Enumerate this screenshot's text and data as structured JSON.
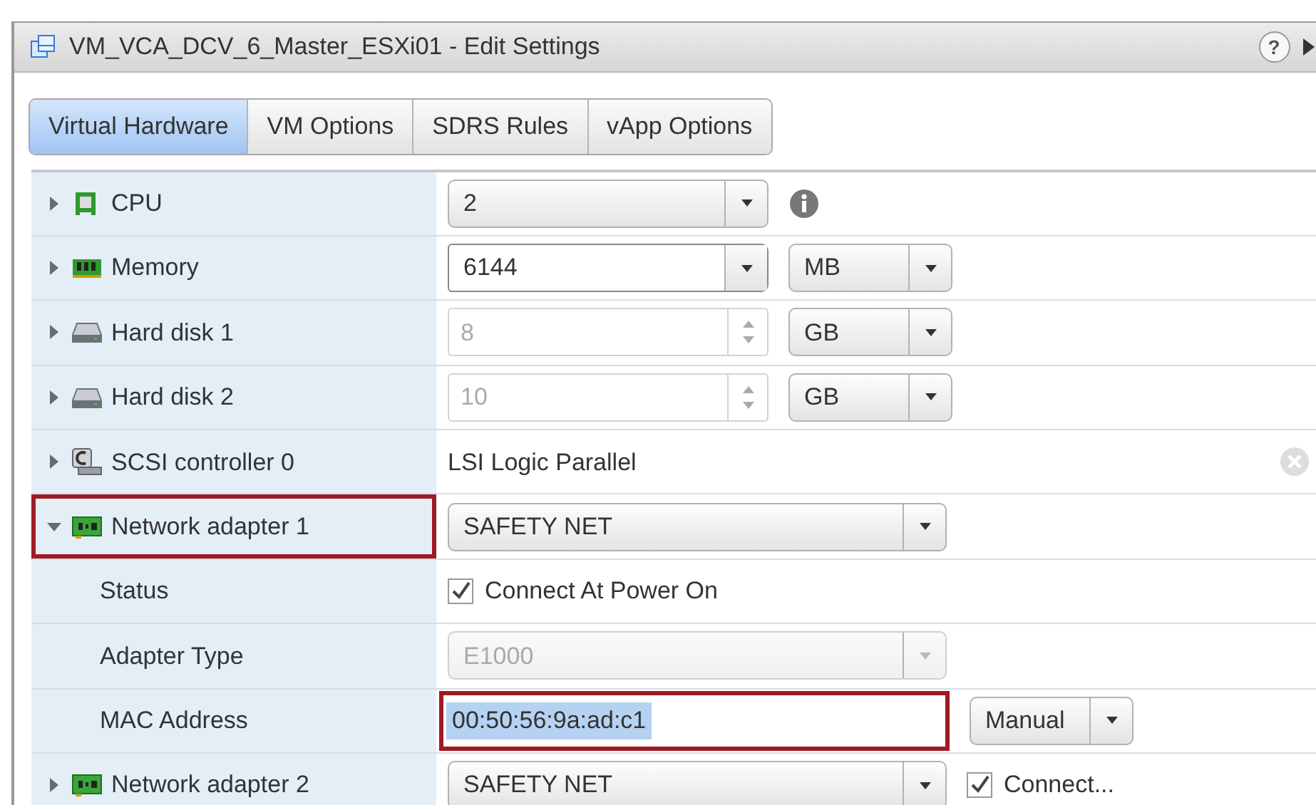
{
  "window": {
    "title": "VM_VCA_DCV_6_Master_ESXi01 - Edit Settings",
    "help": "?"
  },
  "tabs": [
    {
      "label": "Virtual Hardware",
      "selected": true
    },
    {
      "label": "VM Options",
      "selected": false
    },
    {
      "label": "SDRS Rules",
      "selected": false
    },
    {
      "label": "vApp Options",
      "selected": false
    }
  ],
  "rows": [
    {
      "kind": "cpu",
      "label": "CPU",
      "expanded": false,
      "outlined": false,
      "controls": [
        {
          "kind": "count-select",
          "value": "2",
          "disabled": false
        },
        {
          "kind": "info"
        }
      ]
    },
    {
      "kind": "memory",
      "label": "Memory",
      "expanded": false,
      "outlined": false,
      "controls": [
        {
          "kind": "combo",
          "value": "6144",
          "disabled": false
        },
        {
          "kind": "unit-select",
          "value": "MB",
          "disabled": false
        }
      ]
    },
    {
      "kind": "disk",
      "label": "Hard disk 1",
      "expanded": false,
      "outlined": false,
      "controls": [
        {
          "kind": "spinner",
          "value": "8",
          "disabled": true
        },
        {
          "kind": "unit-select",
          "value": "GB",
          "disabled": false
        }
      ]
    },
    {
      "kind": "disk",
      "label": "Hard disk 2",
      "expanded": false,
      "outlined": false,
      "controls": [
        {
          "kind": "spinner",
          "value": "10",
          "disabled": true
        },
        {
          "kind": "unit-select",
          "value": "GB",
          "disabled": false
        }
      ]
    },
    {
      "kind": "controller",
      "label": "SCSI controller 0",
      "expanded": false,
      "outlined": false,
      "controls": [
        {
          "kind": "text",
          "value": "LSI Logic Parallel"
        },
        {
          "kind": "clear"
        }
      ]
    },
    {
      "kind": "network",
      "label": "Network adapter 1",
      "expanded": true,
      "outlined": true,
      "controls": [
        {
          "kind": "select",
          "value": "SAFETY NET",
          "disabled": false
        }
      ]
    },
    {
      "kind": "property",
      "label": "Status",
      "outlined": false,
      "controls": [
        {
          "kind": "checkbox",
          "value": "Connect At Power On",
          "checked": true
        }
      ]
    },
    {
      "kind": "property",
      "label": "Adapter Type",
      "outlined": false,
      "controls": [
        {
          "kind": "select",
          "value": "E1000",
          "disabled": true
        }
      ]
    },
    {
      "kind": "property",
      "label": "MAC Address",
      "outlined": false,
      "controls": [
        {
          "kind": "mac-field",
          "value": "00:50:56:9a:ad:c1",
          "outlined": true,
          "selected": true
        },
        {
          "kind": "unit-select",
          "value": "Manual",
          "disabled": false
        }
      ]
    },
    {
      "kind": "network",
      "label": "Network adapter 2",
      "expanded": false,
      "outlined": false,
      "controls": [
        {
          "kind": "select",
          "value": "SAFETY NET",
          "disabled": false
        },
        {
          "kind": "checkbox",
          "value": "Connect...",
          "checked": true
        }
      ]
    }
  ]
}
